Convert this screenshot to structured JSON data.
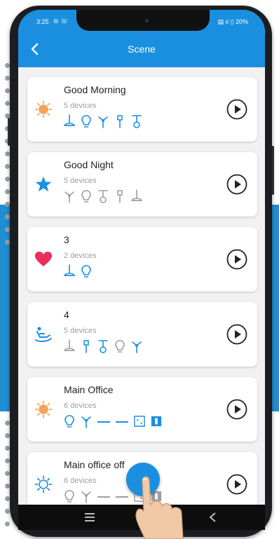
{
  "status_bar": {
    "time": "3:25",
    "battery": "20%"
  },
  "app_bar": {
    "title": "Scene"
  },
  "scenes": [
    {
      "name": "Good Morning",
      "devices": "5 devices",
      "icon": "sun-icon",
      "icon_color": "#f5a35a",
      "device_icons": [
        "ceiling-lamp-icon",
        "bulb-icon",
        "fan-icon",
        "wall-light-icon",
        "pendant-lamp-icon"
      ],
      "device_color": "#1a8fe0"
    },
    {
      "name": "Good Night",
      "devices": "5 devices",
      "icon": "star-icon",
      "icon_color": "#1a8fe0",
      "device_icons": [
        "fan-icon",
        "bulb-icon",
        "pendant-lamp-icon",
        "wall-light-icon",
        "ceiling-lamp-icon"
      ],
      "device_color": "#9e9e9e"
    },
    {
      "name": "3",
      "devices": "2 devices",
      "icon": "heart-icon",
      "icon_color": "#e8305a",
      "device_icons": [
        "ceiling-lamp-icon",
        "bulb-icon"
      ],
      "device_color": "#1a8fe0"
    },
    {
      "name": "4",
      "devices": "5 devices",
      "icon": "recliner-icon",
      "icon_color": "#1a8fe0",
      "device_icons": [
        "ceiling-lamp-icon",
        "wall-light-icon",
        "pendant-lamp-icon",
        "bulb-icon",
        "fan-icon"
      ],
      "device_color": "#1a8fe0",
      "off_indices": [
        0,
        3
      ]
    },
    {
      "name": "Main Office",
      "devices": "6 devices",
      "icon": "sun-icon",
      "icon_color": "#f5a35a",
      "device_icons": [
        "bulb-icon",
        "fan-icon",
        "dash",
        "dash",
        "socket-icon",
        "switch-icon"
      ],
      "device_color": "#1a8fe0"
    },
    {
      "name": "Main office off",
      "devices": "6 devices",
      "icon": "sun-outline-icon",
      "icon_color": "#1a8fe0",
      "device_icons": [
        "bulb-icon",
        "fan-icon",
        "dash",
        "dash",
        "socket-icon",
        "switch-icon"
      ],
      "device_color": "#9e9e9e"
    }
  ],
  "colors": {
    "accent": "#1a8fe0",
    "card_bg": "#ffffff",
    "screen_bg": "#f1f1f1"
  }
}
